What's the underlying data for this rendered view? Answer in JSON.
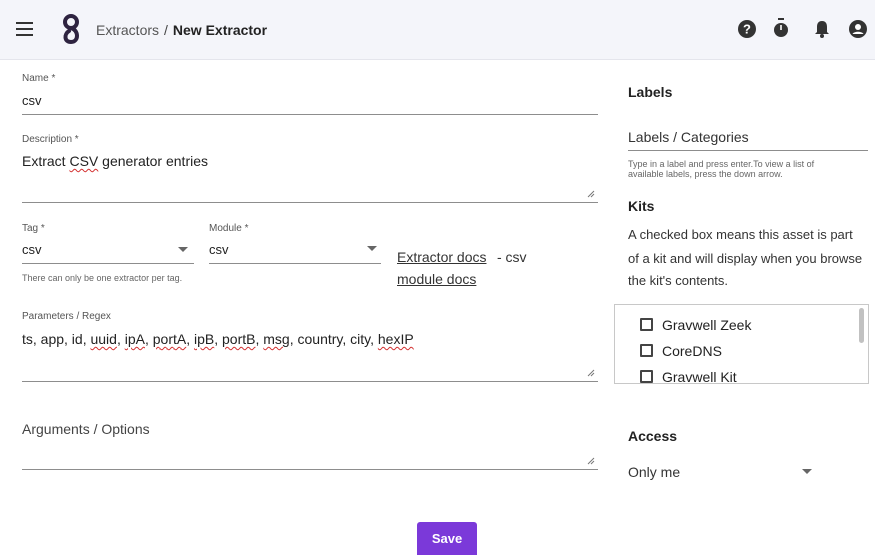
{
  "header": {
    "breadcrumb_parent": "Extractors",
    "breadcrumb_separator": "/",
    "breadcrumb_current": "New Extractor",
    "icons": [
      "menu-icon",
      "help-icon",
      "timer-icon",
      "bell-icon",
      "account-icon"
    ]
  },
  "form": {
    "name": {
      "label": "Name *",
      "value": "csv"
    },
    "description": {
      "label": "Description *",
      "value_parts": [
        "Extract ",
        "CSV",
        " generator entries"
      ]
    },
    "tag": {
      "label": "Tag *",
      "value": "csv",
      "helper": "There can only be one extractor per tag."
    },
    "module": {
      "label": "Module *",
      "value": "csv"
    },
    "docs": {
      "extractor_docs": "Extractor docs ",
      "dash_csv": "- csv",
      "module_docs": "module docs"
    },
    "parameters": {
      "label": "Parameters / Regex",
      "tokens": [
        {
          "t": "ts, app, id, ",
          "s": false
        },
        {
          "t": "uuid",
          "s": true
        },
        {
          "t": ", ",
          "s": false
        },
        {
          "t": "ipA",
          "s": true
        },
        {
          "t": ", ",
          "s": false
        },
        {
          "t": "portA",
          "s": true
        },
        {
          "t": ", ",
          "s": false
        },
        {
          "t": "ipB",
          "s": true
        },
        {
          "t": ", ",
          "s": false
        },
        {
          "t": "portB",
          "s": true
        },
        {
          "t": ", ",
          "s": false
        },
        {
          "t": "msg",
          "s": true
        },
        {
          "t": ", country, city, ",
          "s": false
        },
        {
          "t": "hexIP",
          "s": true
        }
      ]
    },
    "arguments": {
      "placeholder": "Arguments / Options"
    },
    "save_label": "Save"
  },
  "sidebar": {
    "labels_title": "Labels",
    "labels_placeholder": "Labels / Categories",
    "labels_helper_1": "Type in a label and press enter.To view a list of",
    "labels_helper_2": "available labels, press the down arrow.",
    "kits_title": "Kits",
    "kits_desc_1": "A checked box means this asset is part",
    "kits_desc_2": "of a kit and will display when you browse",
    "kits_desc_3": "the kit's contents.",
    "kits": [
      {
        "name": "Gravwell Zeek",
        "checked": false
      },
      {
        "name": "CoreDNS",
        "checked": false
      },
      {
        "name": "Gravwell Kit",
        "checked": false
      }
    ],
    "access_title": "Access",
    "access_value": "Only me"
  },
  "colors": {
    "accent": "#7b39d9",
    "header_bg": "#f4f5fa",
    "spell_error": "#d32f2f"
  }
}
